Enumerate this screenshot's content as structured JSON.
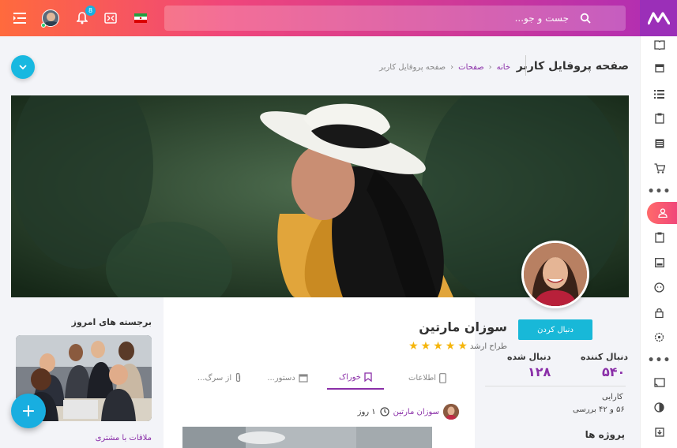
{
  "header": {
    "search_placeholder": "جست و جو...",
    "notification_count": "8"
  },
  "breadcrumb": {
    "page_title": "صفحه پروفایل کاربر",
    "items": [
      "خانه",
      "صفحات",
      "صفحه پروفایل کاربر"
    ]
  },
  "profile": {
    "name": "سوزان مارتین",
    "role": "طراح ارشد",
    "rating": 5,
    "follow_label": "دنبال کردن",
    "followers_label": "دنبال کننده",
    "followers_value": "۵۴۰",
    "following_label": "دنبال شده",
    "following_value": "۱۲۸",
    "efficiency_label": "کارایی",
    "efficiency_value": "۵۶ و ۴۲ بررسی",
    "projects_label": "پروژه ها"
  },
  "tabs": [
    {
      "label": "اطلاعات",
      "icon": "phone-icon"
    },
    {
      "label": "خوراک",
      "icon": "bookmark-icon"
    },
    {
      "label": "دستور...",
      "icon": "calendar-icon"
    },
    {
      "label": "از سرگ...",
      "icon": "paperclip-icon"
    }
  ],
  "post": {
    "author": "سوزان مارتین",
    "time": "۱ روز"
  },
  "highlights": {
    "title": "برجسته های امروز",
    "link": "ملاقات با مشتری"
  },
  "colors": {
    "accent": "#8a2fa8",
    "cyan": "#18b8e0",
    "star": "#f5b50b"
  }
}
